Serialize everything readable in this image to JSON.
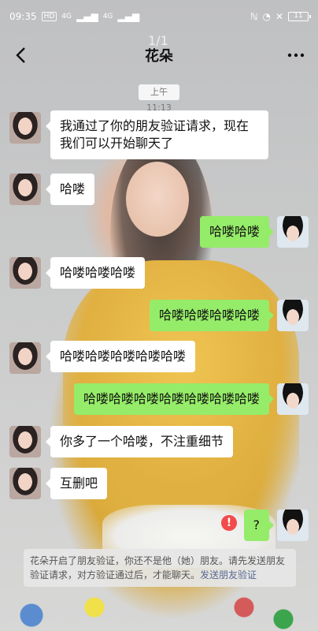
{
  "status_bar": {
    "time": "09:35",
    "sim1": "HD",
    "sim2": "HD",
    "signal1": "4G",
    "signal2": "4G",
    "battery": "11"
  },
  "header": {
    "title": "花朵",
    "page_indicator": "1/1"
  },
  "timestamp": "上午11:13",
  "messages": [
    {
      "side": "left",
      "text_line1": "我通过了你的朋友验证请求，现在",
      "text_line2": "我们可以开始聊天了"
    },
    {
      "side": "left",
      "text": "哈喽"
    },
    {
      "side": "right",
      "text": "哈喽哈喽"
    },
    {
      "side": "left",
      "text": "哈喽哈喽哈喽"
    },
    {
      "side": "right",
      "text": "哈喽哈喽哈喽哈喽"
    },
    {
      "side": "left",
      "text": "哈喽哈喽哈喽哈喽哈喽"
    },
    {
      "side": "right",
      "text": "哈喽哈喽哈喽哈喽哈喽哈喽哈喽"
    },
    {
      "side": "left",
      "text": "你多了一个哈喽，不注重细节"
    },
    {
      "side": "left",
      "text": "互删吧"
    },
    {
      "side": "right",
      "text": "?",
      "failed": true
    }
  ],
  "system_note": {
    "text": "花朵开启了朋友验证，你还不是他（她）朋友。请先发送朋友验证请求，对方验证通过后，才能聊天。",
    "link": "发送朋友验证"
  },
  "colors": {
    "bubble_right": "#95ec69",
    "bubble_left": "#ffffff",
    "error": "#f14b4b",
    "link": "#576b95"
  }
}
